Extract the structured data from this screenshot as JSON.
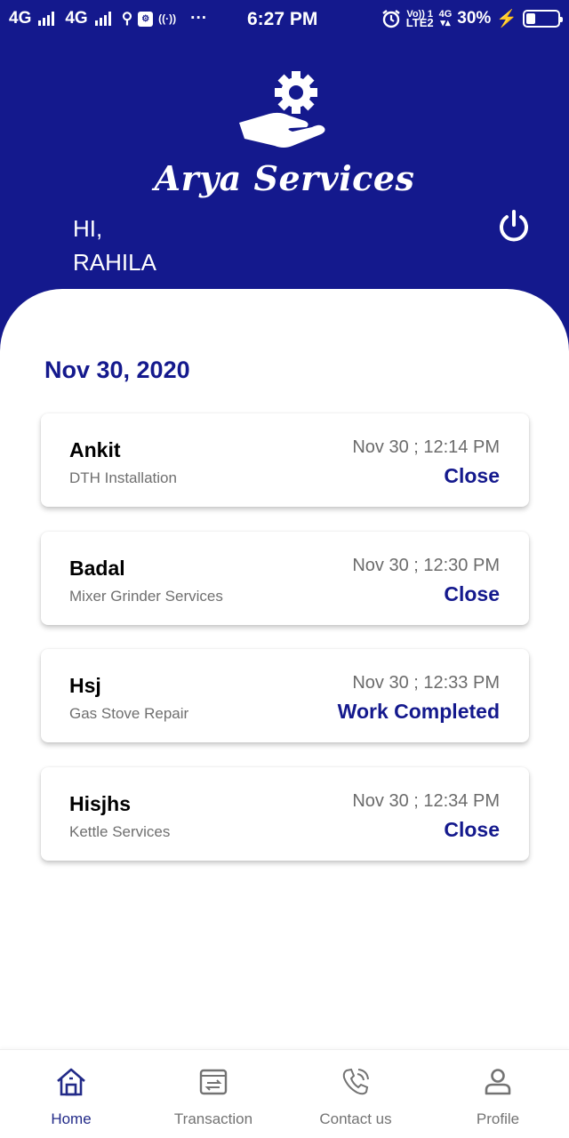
{
  "status_bar": {
    "network_1": "4G",
    "network_2": "4G",
    "time": "6:27 PM",
    "volte_top": "Vo)) 1",
    "volte_bottom": "LTE2",
    "data_type": "4G",
    "battery": "30%",
    "battery_level": 0.3,
    "more": "···"
  },
  "header": {
    "brand": "Arya Services",
    "greeting": "HI,",
    "user_name": "RAHILA",
    "colors": {
      "primary": "#14198d",
      "text_on_primary": "#ffffff"
    }
  },
  "main": {
    "date_heading": "Nov 30, 2020",
    "bookings": [
      {
        "name": "Ankit",
        "service": "DTH Installation",
        "datetime": "Nov 30 ; 12:14 PM",
        "status": "Close"
      },
      {
        "name": "Badal",
        "service": "Mixer Grinder Services",
        "datetime": "Nov 30 ; 12:30 PM",
        "status": "Close"
      },
      {
        "name": "Hsj",
        "service": "Gas Stove Repair",
        "datetime": "Nov 30 ; 12:33 PM",
        "status": "Work Completed"
      },
      {
        "name": "Hisjhs",
        "service": "Kettle Services",
        "datetime": "Nov 30 ; 12:34 PM",
        "status": "Close"
      }
    ]
  },
  "bottom_nav": {
    "items": [
      {
        "label": "Home",
        "icon": "home-icon",
        "active": true
      },
      {
        "label": "Transaction",
        "icon": "transaction-icon",
        "active": false
      },
      {
        "label": "Contact us",
        "icon": "phone-call-icon",
        "active": false
      },
      {
        "label": "Profile",
        "icon": "person-icon",
        "active": false
      }
    ]
  }
}
